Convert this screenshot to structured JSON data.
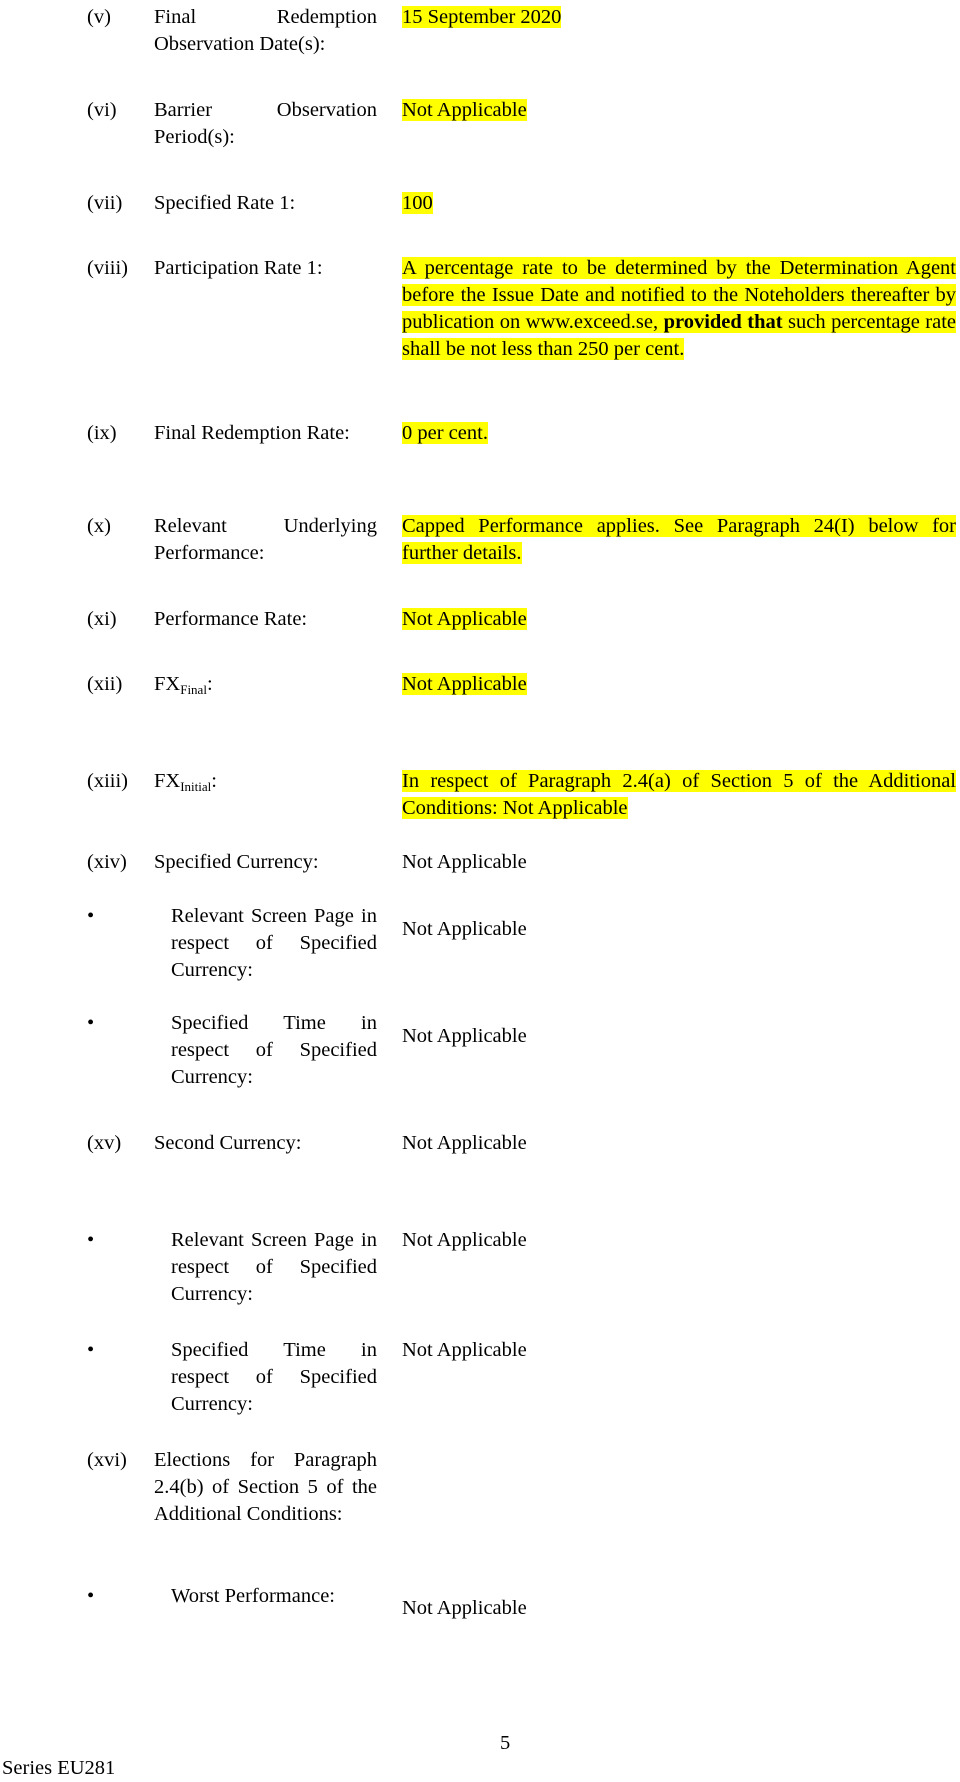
{
  "highlight_color": "#ffff00",
  "items": [
    {
      "num": "(v)",
      "label": "Final Redemption Observation Date(s):",
      "value": "15 September 2020",
      "highlighted": true
    },
    {
      "num": "(vi)",
      "label": "Barrier Observation Period(s):",
      "value": "Not Applicable",
      "highlighted": true
    },
    {
      "num": "(vii)",
      "label": "Specified Rate 1:",
      "value": "100",
      "highlighted": true
    },
    {
      "num": "(viii)",
      "label": "Participation Rate 1:",
      "value_part1": "A percentage rate to be determined by the Determination Agent before the Issue Date and notified to the Noteholders thereafter by publication on www.exceed.se,",
      "value_bold": "provided that",
      "value_part2": "such percentage rate shall be not less than 250 per cent.",
      "highlighted": true
    },
    {
      "num": "(ix)",
      "label": "Final Redemption Rate:",
      "value": "0 per cent.",
      "highlighted": true
    },
    {
      "num": "(x)",
      "label": "Relevant Underlying Performance:",
      "value": "Capped Performance applies. See Paragraph 24(I) below for further details.",
      "highlighted": true
    },
    {
      "num": "(xi)",
      "label": "Performance Rate:",
      "value": "Not Applicable",
      "highlighted": true
    },
    {
      "num": "(xii)",
      "label_main": "FX",
      "label_sub": "Final",
      "label_suffix": ":",
      "value": "Not Applicable",
      "highlighted": true
    },
    {
      "num": "(xiii)",
      "label_main": "FX",
      "label_sub": "Initial",
      "label_suffix": ":",
      "value": "In respect of Paragraph 2.4(a) of Section 5 of the Additional Conditions: Not Applicable",
      "highlighted": true
    },
    {
      "num": "(xiv)",
      "label": "Specified Currency:",
      "value": "Not Applicable",
      "highlighted": false
    },
    {
      "bullet": "•",
      "label": "Relevant Screen Page in respect of Specified Currency:",
      "value": "Not Applicable",
      "highlighted": false
    },
    {
      "bullet": "•",
      "label": "Specified Time in respect of Specified Currency:",
      "value": "Not Applicable",
      "highlighted": false
    },
    {
      "num": "(xv)",
      "label": "Second Currency:",
      "value": "Not Applicable",
      "highlighted": false
    },
    {
      "bullet": "•",
      "label": "Relevant Screen Page in respect of Specified Currency:",
      "value": "Not Applicable",
      "highlighted": false
    },
    {
      "bullet": "•",
      "label": "Specified Time in respect of Specified Currency:",
      "value": "Not Applicable",
      "highlighted": false
    },
    {
      "num": "(xvi)",
      "label": "Elections for Paragraph 2.4(b) of Section 5 of the Additional Conditions:",
      "highlighted": false
    },
    {
      "bullet": "•",
      "label": "Worst Performance:",
      "value": "Not Applicable",
      "highlighted": false
    }
  ],
  "footer": {
    "page_number": "5",
    "series": "Series EU281"
  }
}
